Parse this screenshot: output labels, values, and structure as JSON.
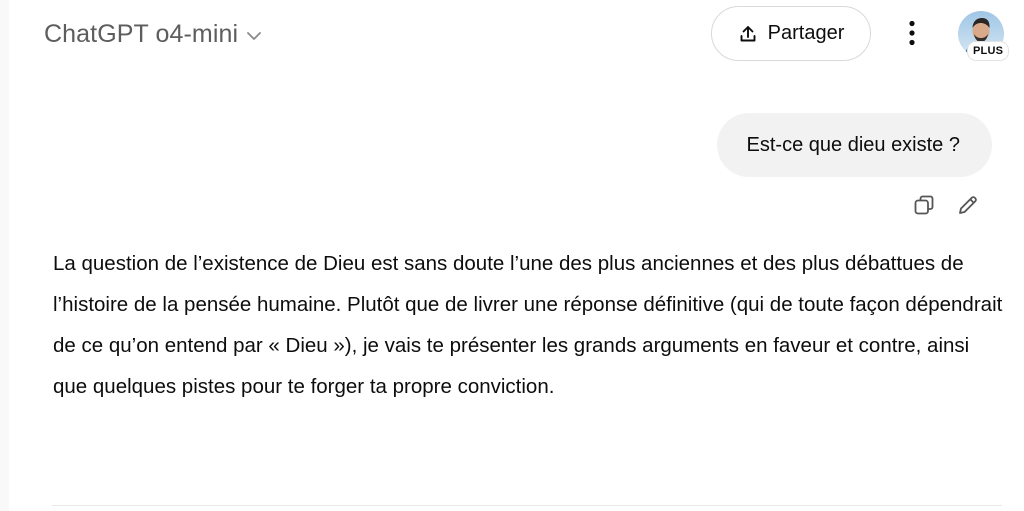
{
  "header": {
    "model_name": "ChatGPT o4-mini",
    "share_label": "Partager",
    "plan_badge": "PLUS"
  },
  "icons": {
    "model_chevron": "chevron-down-icon",
    "share": "upload-icon",
    "more": "vertical-dots-icon",
    "copy": "copy-icon",
    "edit": "pencil-icon"
  },
  "conversation": {
    "user_message": "Est-ce que dieu existe ?",
    "assistant_message": "La question de l’existence de Dieu est sans doute l’une des plus anciennes et des plus débattues de l’histoire de la pensée humaine. Plutôt que de livrer une réponse définitive (qui de toute façon dépendrait de ce qu’on entend par « Dieu »), je vais te présenter les grands arguments en faveur et contre, ainsi que quelques pistes pour te forger ta propre conviction."
  },
  "colors": {
    "user_bubble": "#f2f2f2",
    "text_primary": "#0d0d0d",
    "text_secondary": "#5d5d5d",
    "border": "#d9d9d9"
  }
}
